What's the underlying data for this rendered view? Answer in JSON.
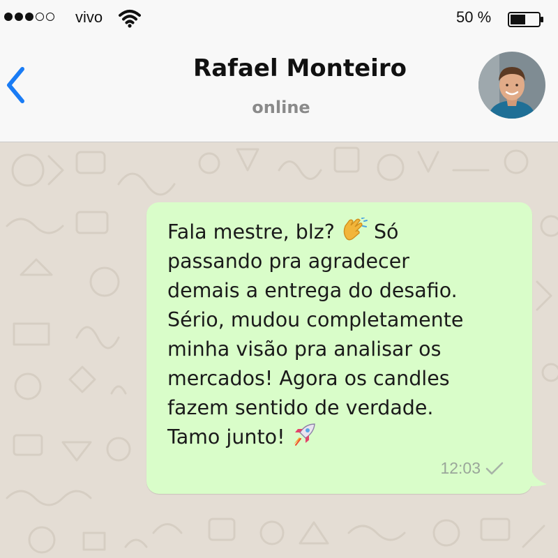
{
  "status_bar": {
    "carrier": "vivo",
    "battery_percent": "50 %",
    "signal_bars_filled": 3,
    "signal_bars_total": 5
  },
  "header": {
    "contact_name": "Rafael Monteiro",
    "contact_status": "online"
  },
  "message": {
    "parts": [
      "Fala mestre, blz? ",
      " Só\npassando pra agradecer\ndemais a entrega do desafio.\nSério, mudou completamente\nminha visão pra analisar os\nmercados! Agora os candles\nfazem sentido de verdade.\nTamo junto! "
    ],
    "emojis": [
      "clapping-hands-icon",
      "rocket-icon"
    ],
    "time": "12:03",
    "status": "sent-check"
  },
  "colors": {
    "accent": "#1a7cf5",
    "bubble": "#d9fdc9",
    "chat_background": "#e4ddd4",
    "header_background": "#f8f8f8",
    "status_text": "#8a8a8a",
    "time_text": "#9aa69a"
  }
}
